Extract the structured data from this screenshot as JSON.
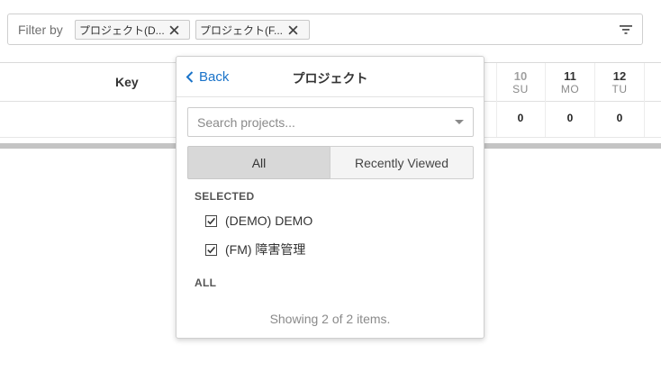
{
  "filter_bar": {
    "label": "Filter by",
    "chips": [
      {
        "label": "プロジェクト(D..."
      },
      {
        "label": "プロジェクト(F..."
      }
    ],
    "filter_icon": "filter-icon"
  },
  "table": {
    "key_header": "Key",
    "days": [
      {
        "num": "10",
        "weekday": "SU",
        "value": "0"
      },
      {
        "num": "11",
        "weekday": "MO",
        "value": "0"
      },
      {
        "num": "12",
        "weekday": "TU",
        "value": "0"
      }
    ]
  },
  "popup": {
    "back_label": "Back",
    "title": "プロジェクト",
    "search_placeholder": "Search projects...",
    "tabs": {
      "all": "All",
      "recent": "Recently Viewed"
    },
    "selected_section": "SELECTED",
    "selected_items": [
      {
        "label": "(DEMO) DEMO",
        "checked": true
      },
      {
        "label": "(FM) 障害管理",
        "checked": true
      }
    ],
    "all_section": "ALL",
    "footer": "Showing 2 of 2 items."
  },
  "colors": {
    "link": "#1a73c9",
    "active_tab": "#d8d8d8"
  }
}
